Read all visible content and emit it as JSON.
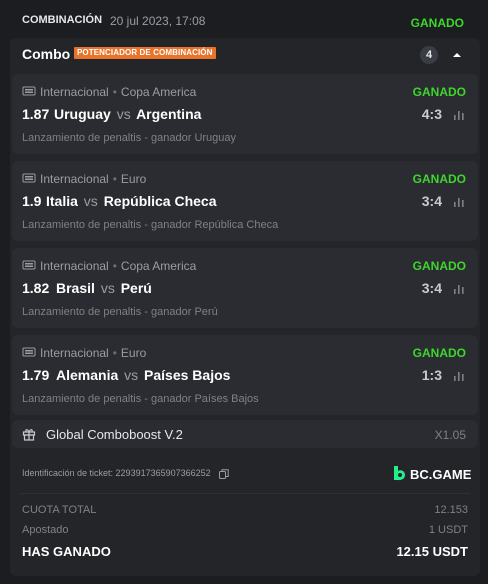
{
  "header": {
    "title": "COMBINACIÓN",
    "date": "20 jul 2023, 17:08",
    "status": "GANADO"
  },
  "combo": {
    "name": "Combo",
    "badge": "POTENCIADOR DE COMBINACIÓN",
    "count": "4",
    "toggle_icon": "chevron-up-icon"
  },
  "bets": [
    {
      "league": "Internacional",
      "competition": "Copa America",
      "status": "GANADO",
      "odds": "1.87",
      "home": "Uruguay",
      "vs": "vs",
      "away": "Argentina",
      "score": "4:3",
      "market": "Lanzamiento de penaltis - ganador Uruguay"
    },
    {
      "league": "Internacional",
      "competition": "Euro",
      "status": "GANADO",
      "odds": "1.9",
      "home": "Italia",
      "vs": "vs",
      "away": "República Checa",
      "score": "3:4",
      "market": "Lanzamiento de penaltis - ganador República Checa"
    },
    {
      "league": "Internacional",
      "competition": "Copa America",
      "status": "GANADO",
      "odds": "1.82",
      "home": "Brasil",
      "vs": "vs",
      "away": "Perú",
      "score": "3:4",
      "market": "Lanzamiento de penaltis - ganador Perú"
    },
    {
      "league": "Internacional",
      "competition": "Euro",
      "status": "GANADO",
      "odds": "1.79",
      "home": "Alemania",
      "vs": "vs",
      "away": "Países Bajos",
      "score": "1:3",
      "market": "Lanzamiento de penaltis - ganador Países Bajos"
    }
  ],
  "boost": {
    "label": "Global Comboboost V.2",
    "multiplier": "X1.05"
  },
  "ticket": {
    "label": "Identificación de ticket: 2293917365907366252",
    "brand": "BC.GAME"
  },
  "summary": {
    "total_odds_label": "CUOTA TOTAL",
    "total_odds_value": "12.153",
    "staked_label": "Apostado",
    "staked_value": "1 USDT",
    "won_label": "HAS GANADO",
    "won_value": "12.15 USDT"
  },
  "colors": {
    "win_green": "#3ed62c",
    "badge_orange": "#e7742a",
    "brand_green": "#24ee89"
  }
}
